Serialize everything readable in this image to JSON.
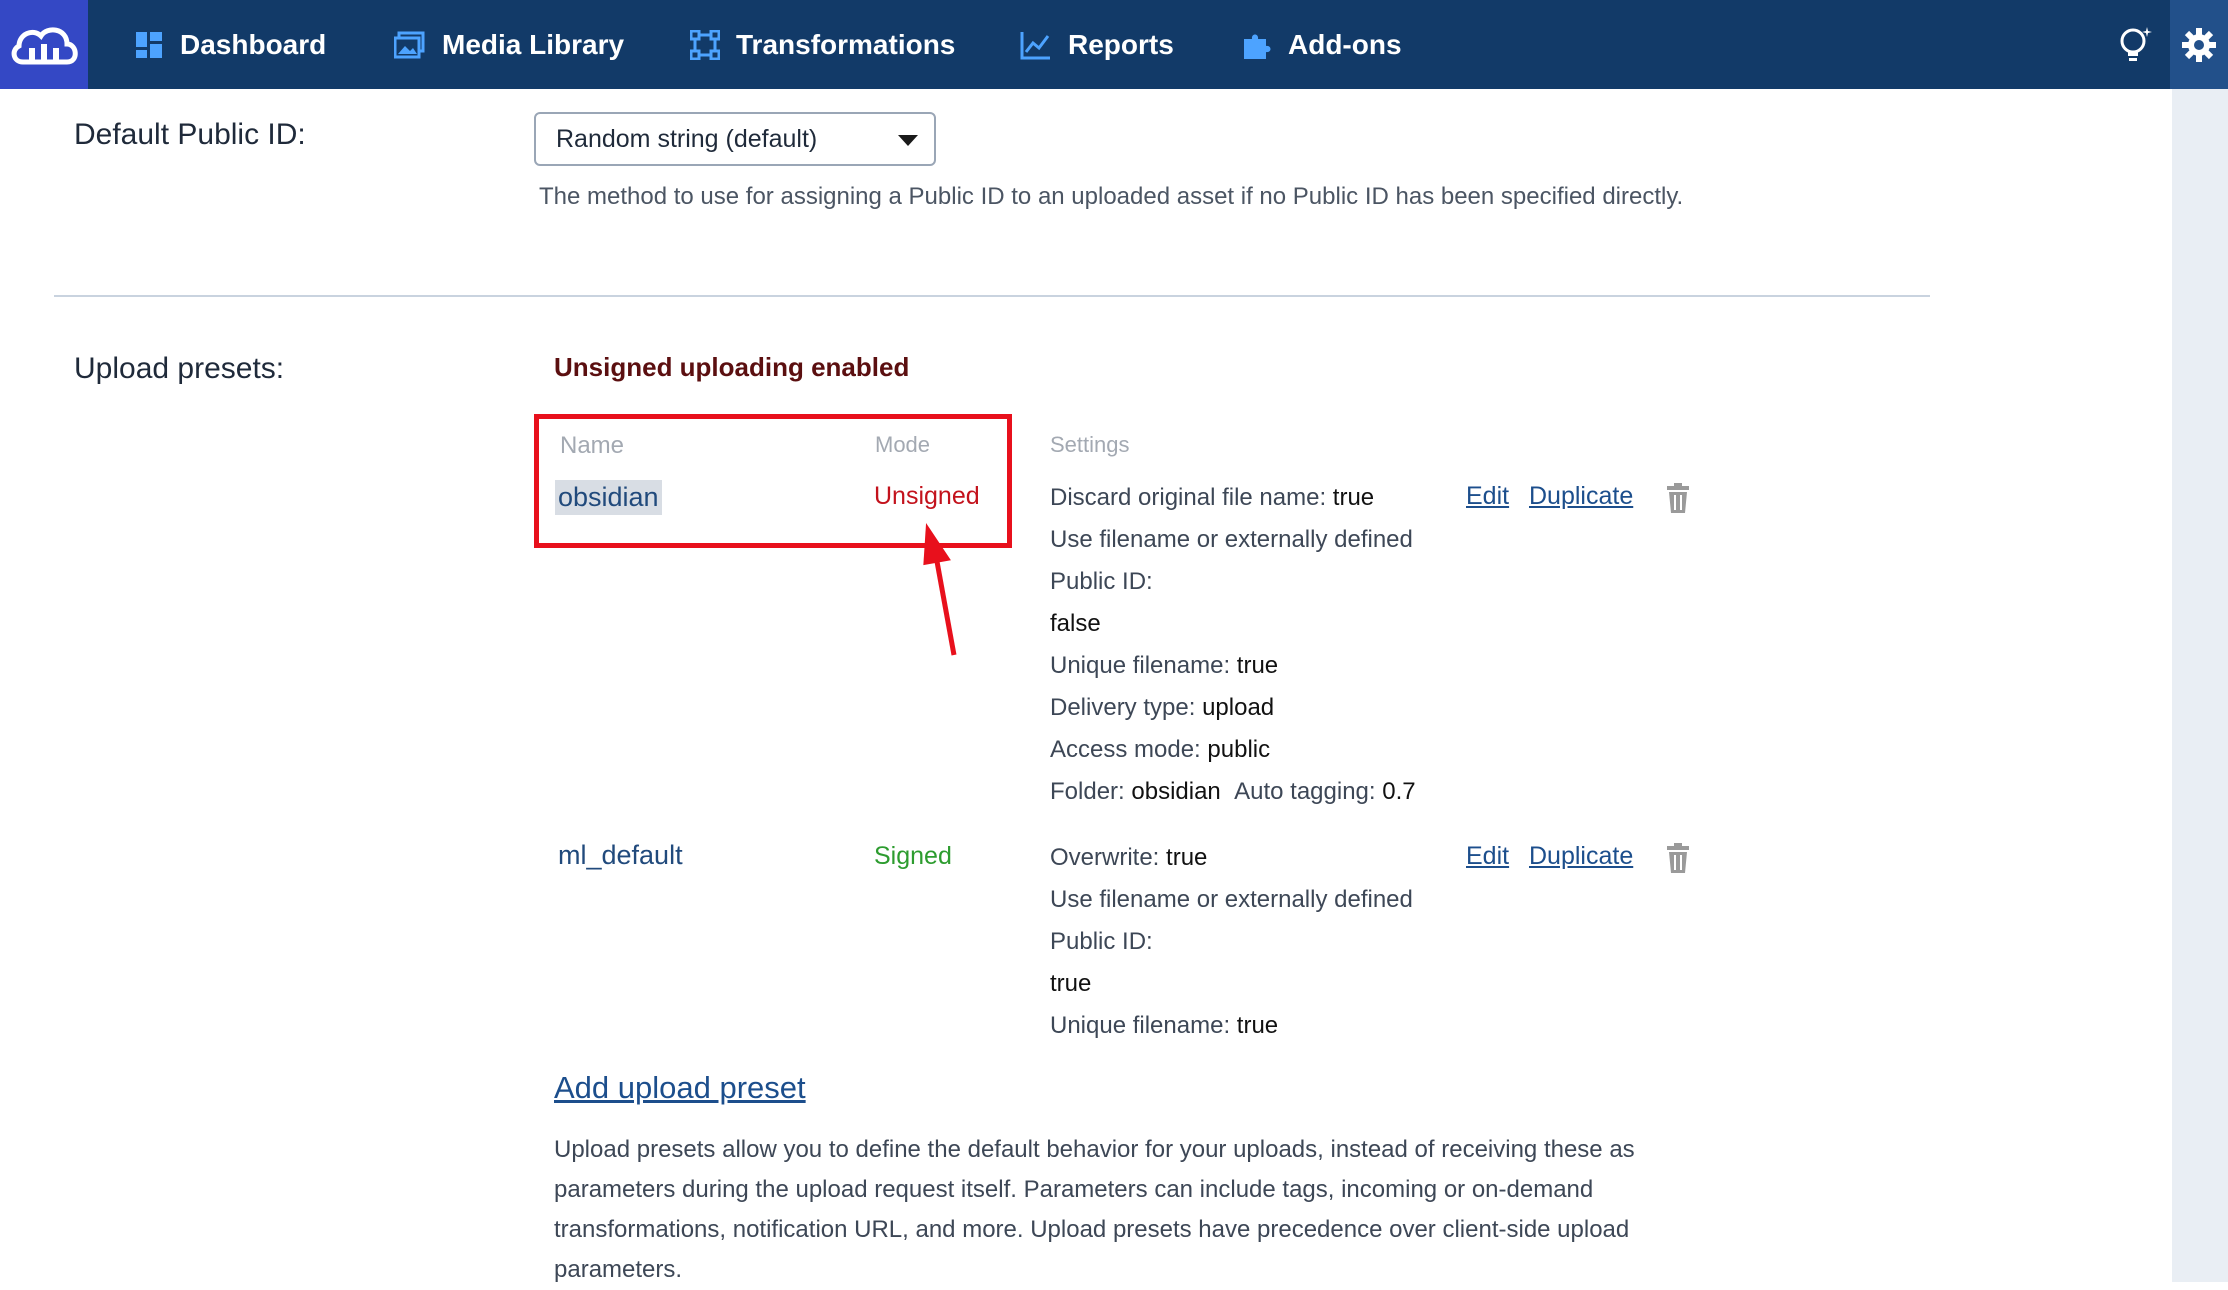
{
  "nav": {
    "items": [
      {
        "label": "Dashboard",
        "icon": "dashboard-icon"
      },
      {
        "label": "Media Library",
        "icon": "media-library-icon"
      },
      {
        "label": "Transformations",
        "icon": "transformations-icon"
      },
      {
        "label": "Reports",
        "icon": "reports-icon"
      },
      {
        "label": "Add-ons",
        "icon": "addons-puzzle-icon"
      }
    ],
    "logo_icon": "cloud-logo-icon",
    "tips_icon": "lightbulb-icon",
    "settings_icon": "gear-icon"
  },
  "default_public_id": {
    "label": "Default Public ID:",
    "selected": "Random string (default)",
    "help": "The method to use for assigning a Public ID to an uploaded asset if no Public ID has been specified directly."
  },
  "upload_presets": {
    "label": "Upload presets:",
    "status": "Unsigned uploading enabled",
    "columns": {
      "name": "Name",
      "mode": "Mode",
      "settings": "Settings"
    },
    "rows": [
      {
        "name": "obsidian",
        "mode": "Unsigned",
        "settings": [
          {
            "k": "Discard original file name:",
            "v": "true"
          },
          {
            "k": "Use filename or externally defined",
            "v": ""
          },
          {
            "k": "Public ID:",
            "v": ""
          },
          {
            "k": "",
            "v": "false"
          },
          {
            "k": "Unique filename:",
            "v": "true"
          },
          {
            "k": "Delivery type:",
            "v": "upload"
          },
          {
            "k": "Access mode:",
            "v": "public"
          },
          {
            "k": "Folder:",
            "v": "obsidian",
            "k2": "Auto tagging:",
            "v2": "0.7"
          }
        ],
        "edit": "Edit",
        "duplicate": "Duplicate"
      },
      {
        "name": "ml_default",
        "mode": "Signed",
        "settings": [
          {
            "k": "Overwrite:",
            "v": "true"
          },
          {
            "k": "Use filename or externally defined",
            "v": ""
          },
          {
            "k": "Public ID:",
            "v": ""
          },
          {
            "k": "",
            "v": "true"
          },
          {
            "k": "Unique filename:",
            "v": "true"
          }
        ],
        "edit": "Edit",
        "duplicate": "Duplicate"
      }
    ],
    "add_link": "Add upload preset",
    "description": "Upload presets allow you to define the default behavior for your uploads, instead of receiving these as parameters during the upload request itself. Parameters can include tags, incoming or on-demand transformations, notification URL, and more. Upload presets have precedence over client-side upload parameters."
  },
  "colors": {
    "nav_bg": "#123a68",
    "logo_bg": "#3448c5",
    "highlight": "#e8101c",
    "unsigned": "#c3121c",
    "signed": "#2d9c2f",
    "link": "#1c4e8c"
  }
}
